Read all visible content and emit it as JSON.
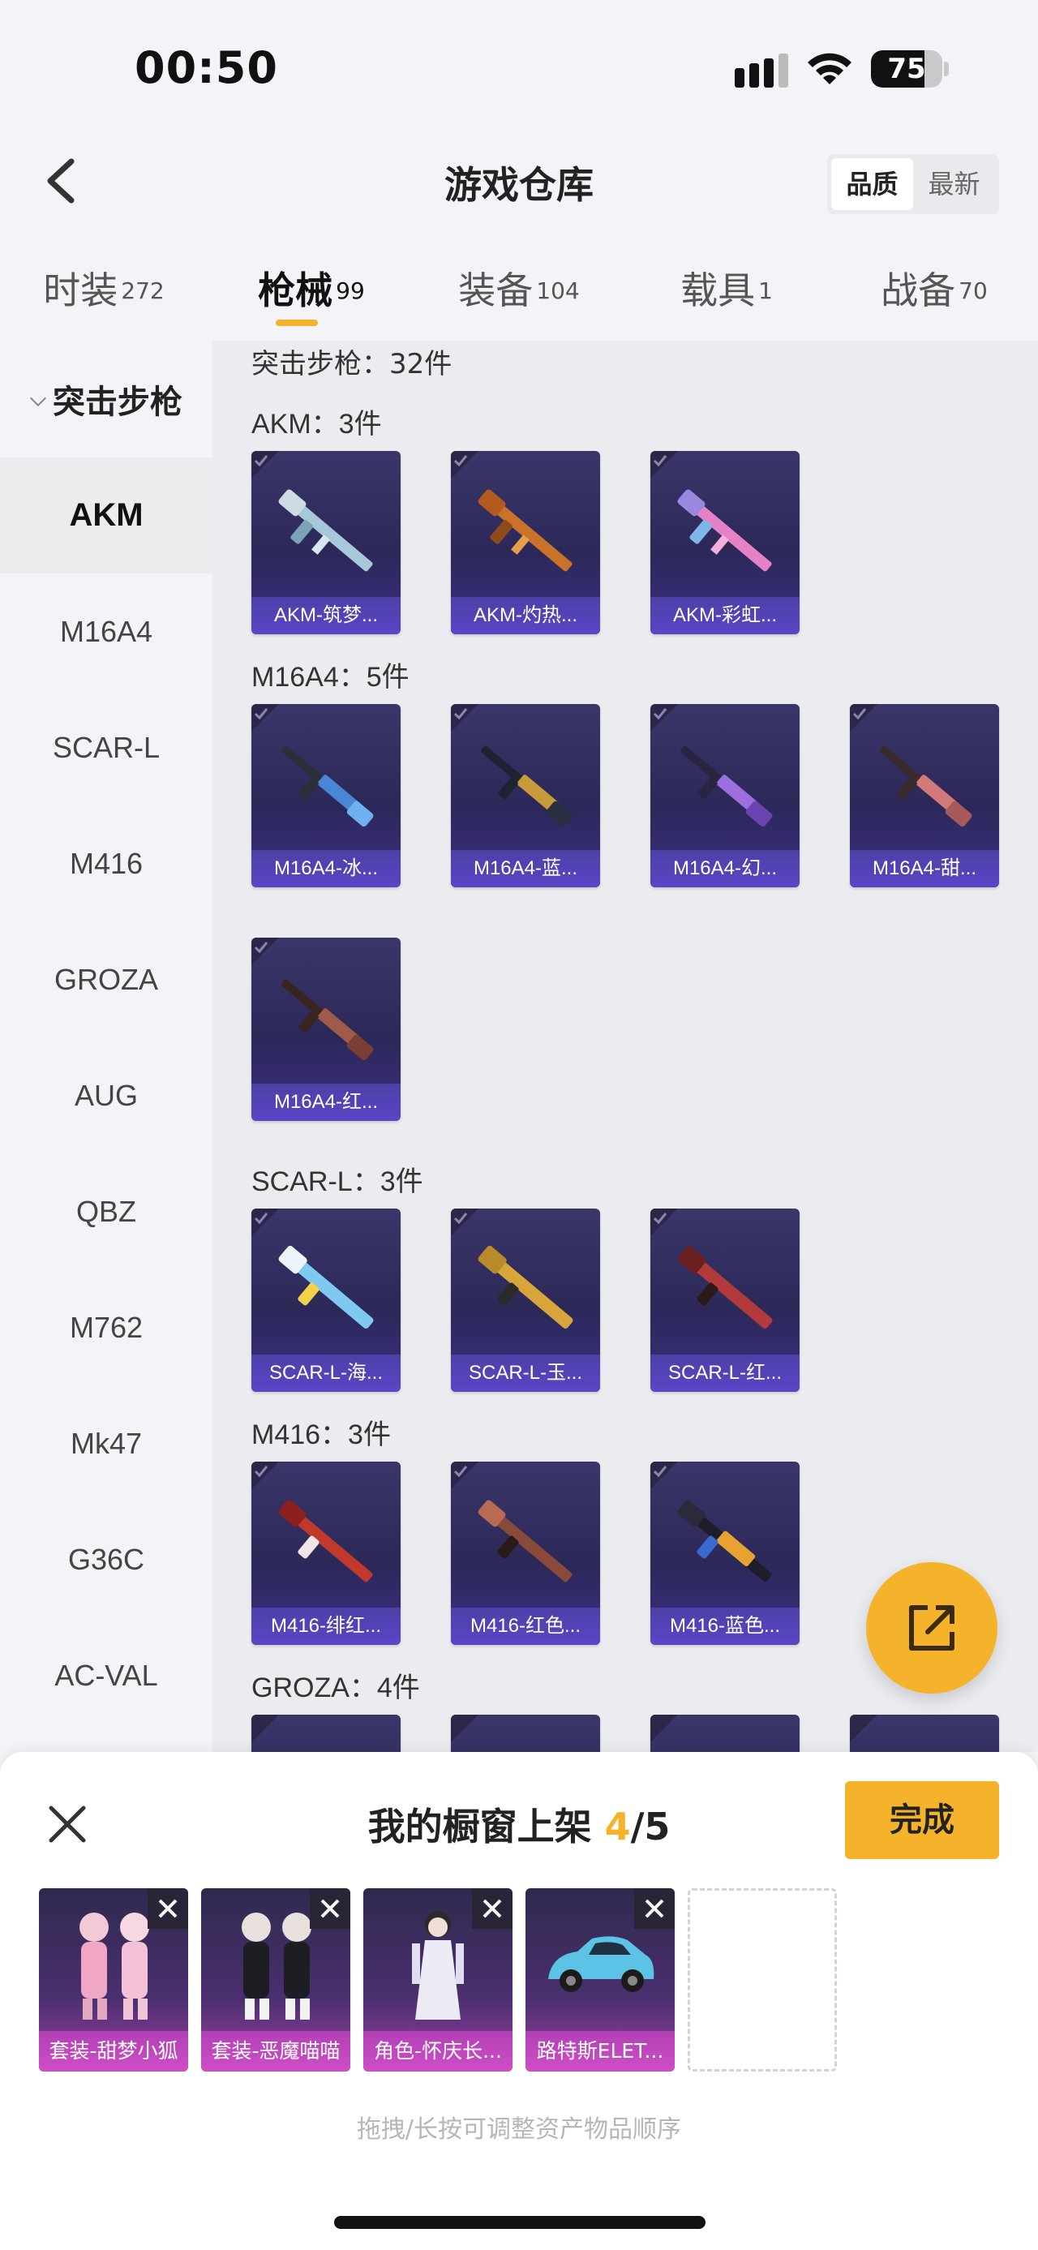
{
  "status": {
    "time": "00:50",
    "battery": "75",
    "battery_level": 0.75
  },
  "header": {
    "title": "游戏仓库",
    "sort_options": [
      "品质",
      "最新"
    ]
  },
  "tabs": [
    {
      "label": "时装",
      "count": "272"
    },
    {
      "label": "枪械",
      "count": "99"
    },
    {
      "label": "装备",
      "count": "104"
    },
    {
      "label": "载具",
      "count": "1"
    },
    {
      "label": "战备",
      "count": "70"
    }
  ],
  "sidebar": {
    "group": "突击步枪",
    "items": [
      "AKM",
      "M16A4",
      "SCAR-L",
      "M416",
      "GROZA",
      "AUG",
      "QBZ",
      "M762",
      "Mk47",
      "G36C",
      "AC-VAL"
    ]
  },
  "main": {
    "subtitle": "突击步枪：32件",
    "groups": [
      {
        "title": "AKM：3件",
        "items": [
          "AKM-筑梦...",
          "AKM-灼热...",
          "AKM-彩虹..."
        ]
      },
      {
        "title": "M16A4：5件",
        "items": [
          "M16A4-冰...",
          "M16A4-蓝...",
          "M16A4-幻...",
          "M16A4-甜...",
          "M16A4-红..."
        ]
      },
      {
        "title": "SCAR-L：3件",
        "items": [
          "SCAR-L-海...",
          "SCAR-L-玉...",
          "SCAR-L-红..."
        ]
      },
      {
        "title": "M416：3件",
        "items": [
          "M416-绯红...",
          "M416-红色...",
          "M416-蓝色..."
        ]
      },
      {
        "title": "GROZA：4件",
        "items": [
          "",
          "",
          "",
          ""
        ]
      }
    ]
  },
  "showcase": {
    "title_prefix": "我的橱窗上架",
    "count": "4",
    "total": "/5",
    "done": "完成",
    "items": [
      "套装-甜梦小狐",
      "套装-恶魔喵喵",
      "角色-怀庆长...",
      "路特斯ELET..."
    ],
    "hint": "拖拽/长按可调整资产物品顺序"
  },
  "colors": {
    "accent": "#f5b22b",
    "card_bg": "#2c2858",
    "caption_purple": "#5946c6",
    "caption_pink": "#cf4dc7"
  }
}
